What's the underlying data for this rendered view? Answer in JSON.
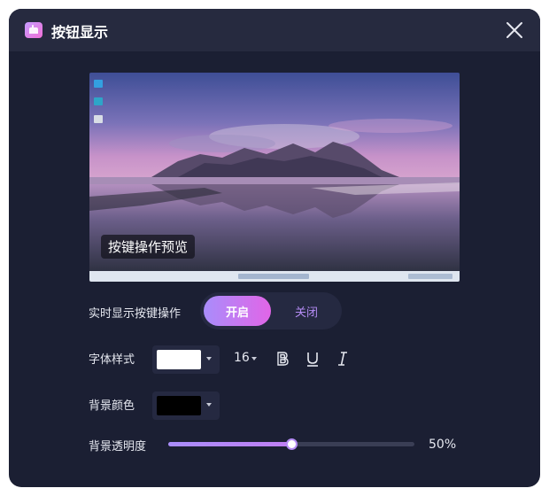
{
  "dialog": {
    "title": "按钮显示",
    "icon": "keyboard-hand-icon",
    "close_icon": "close-icon"
  },
  "preview": {
    "label": "按键操作预览"
  },
  "realtime": {
    "label": "实时显示按键操作",
    "on_label": "开启",
    "off_label": "关闭",
    "selected": "开启"
  },
  "font_style": {
    "label": "字体样式",
    "color": "#ffffff",
    "size": "16",
    "bold_icon": "bold-icon",
    "underline_icon": "underline-icon",
    "italic_icon": "italic-icon"
  },
  "background_color": {
    "label": "背景颜色",
    "color": "#000000"
  },
  "background_opacity": {
    "label": "背景透明度",
    "value": 0.5,
    "display": "50%"
  },
  "colors": {
    "dialog_bg": "#1b1f33",
    "titlebar_bg": "#262a3f",
    "accent_start": "#a98dfb",
    "accent_end": "#e165e7",
    "accent_text": "#b58cf5"
  }
}
